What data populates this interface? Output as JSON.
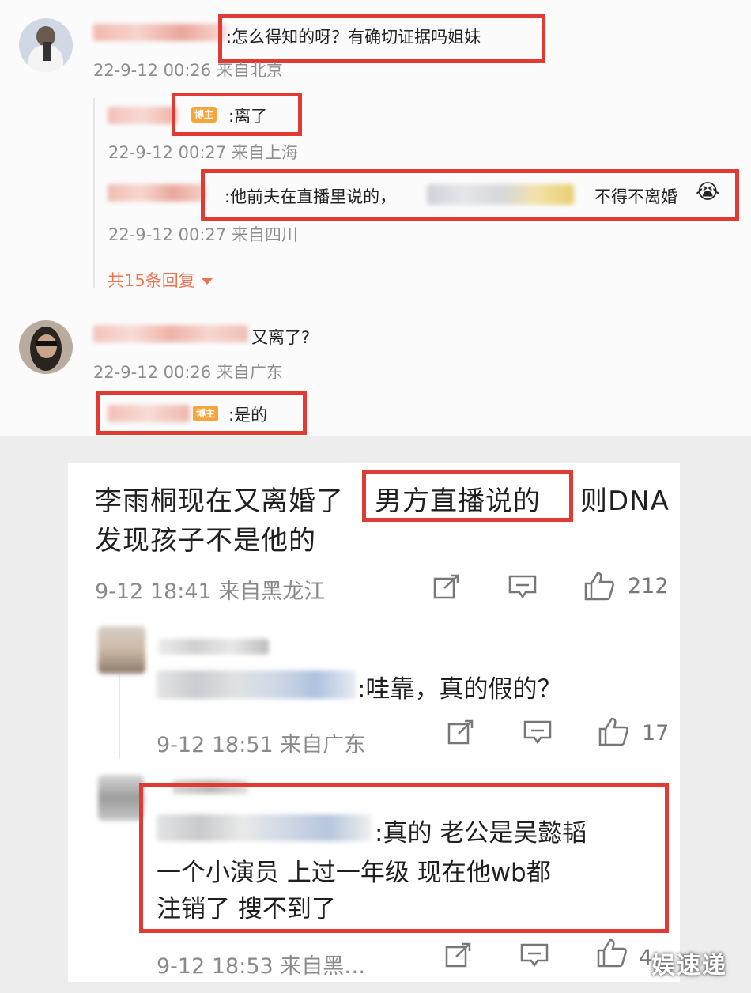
{
  "top_thread": {
    "comment1": {
      "text": ":怎么得知的呀？有确切证据吗姐妹",
      "meta": "22-9-12 00:26 来自北京"
    },
    "reply1": {
      "badge": "博主",
      "text": ":离了",
      "meta": "22-9-12 00:27 来自上海"
    },
    "reply2": {
      "text_a": ":他前夫在直播里说的，",
      "text_b": "不得不离婚",
      "emoji": "😭",
      "meta": "22-9-12 00:27 来自四川"
    },
    "more_replies": "共15条回复",
    "comment2": {
      "text": "又离了?",
      "meta": "22-9-12 00:26 来自广东"
    },
    "reply3": {
      "badge": "博主",
      "text": ":是的"
    }
  },
  "bottom_thread": {
    "post": {
      "line1_a": "李雨桐现在又离婚了",
      "line1_boxed": "男方直播说的",
      "line1_b": "则DNA",
      "line2": "发现孩子不是他的",
      "meta": "9-12 18:41 来自黑龙江",
      "likes": "212"
    },
    "reply_a": {
      "text": ":哇靠，真的假的？",
      "meta": "9-12 18:51 来自广东",
      "likes": "17"
    },
    "reply_b": {
      "line1": ":真的 老公是吴懿韬",
      "line2": "一个小演员 上过一年级 现在他wb都",
      "line3": "注销了 搜不到了",
      "meta": "9-12 18:53 来自黑…",
      "likes": "4"
    }
  },
  "watermark": "娱速递",
  "icons": [
    "share-icon",
    "comment-icon",
    "like-icon",
    "chevron-down-icon"
  ],
  "colors": {
    "highlight_box": "#e03a33",
    "link": "#eb7350",
    "badge": "#f6a53b"
  }
}
